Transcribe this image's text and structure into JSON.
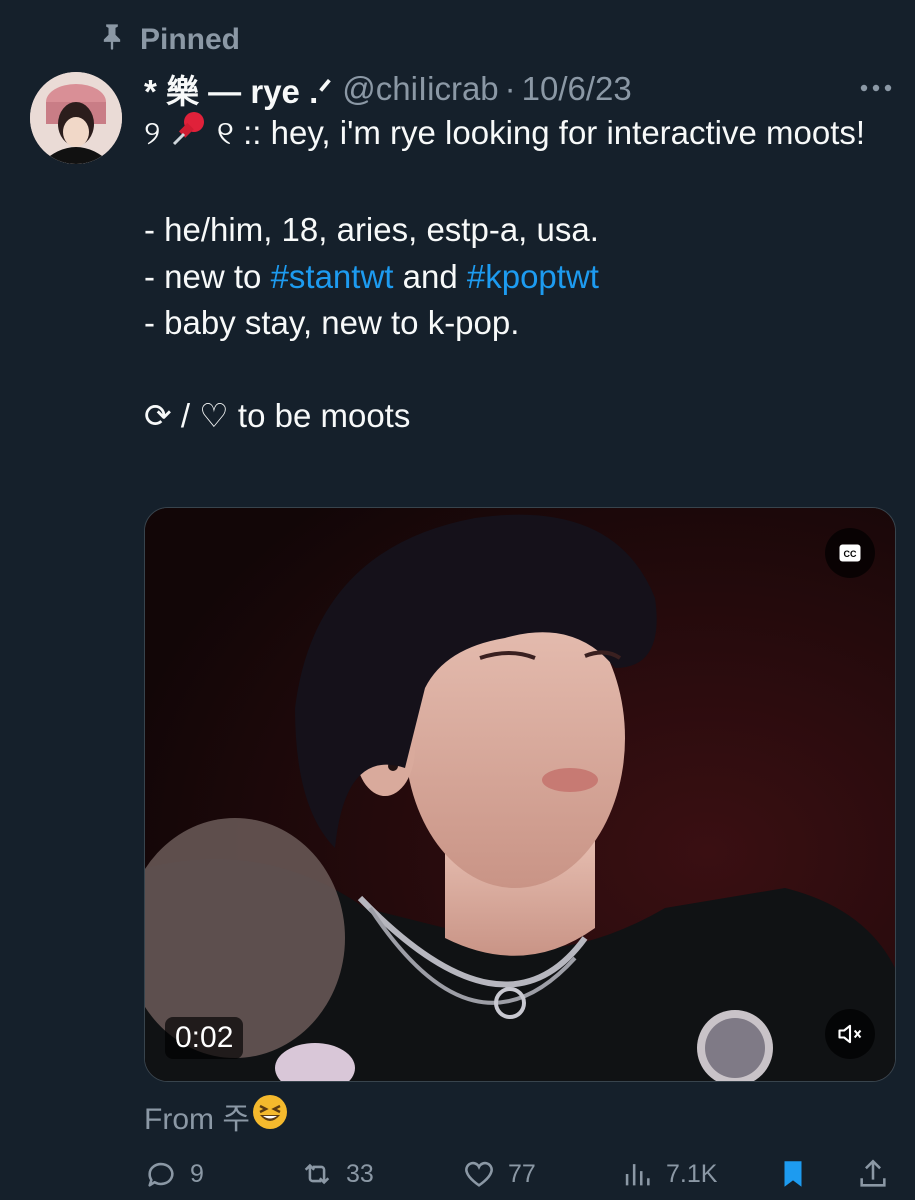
{
  "pinned": {
    "label": "Pinned",
    "icon": "pin-icon"
  },
  "tweet": {
    "display_name": "* 樂 — rye .ᐟ",
    "handle": "@chiIicrab",
    "separator": "·",
    "date": "10/6/23",
    "body": {
      "line1_prefix": "୨",
      "line1_suffix": "୧ ::  hey, i'm rye looking for interactive moots!",
      "line2": "- he/him, 18, aries, estp-a, usa.",
      "line3_prefix": "- new to ",
      "hashtag1": "#stantwt",
      "line3_mid": " and ",
      "hashtag2": "#kpoptwt",
      "line4": "- baby stay, new to k-pop.",
      "line5": "⟳ / ♡ to be moots"
    },
    "media": {
      "type": "video",
      "timestamp": "0:02",
      "cc_label": "CC"
    },
    "from_text": "From 주",
    "from_emoji": "😆",
    "actions": {
      "replies": "9",
      "retweets": "33",
      "likes": "77",
      "views": "7.1K"
    }
  },
  "colors": {
    "background": "#15202b",
    "text": "#f7f9f9",
    "secondary": "#8b98a5",
    "accent": "#1d9bf0"
  }
}
